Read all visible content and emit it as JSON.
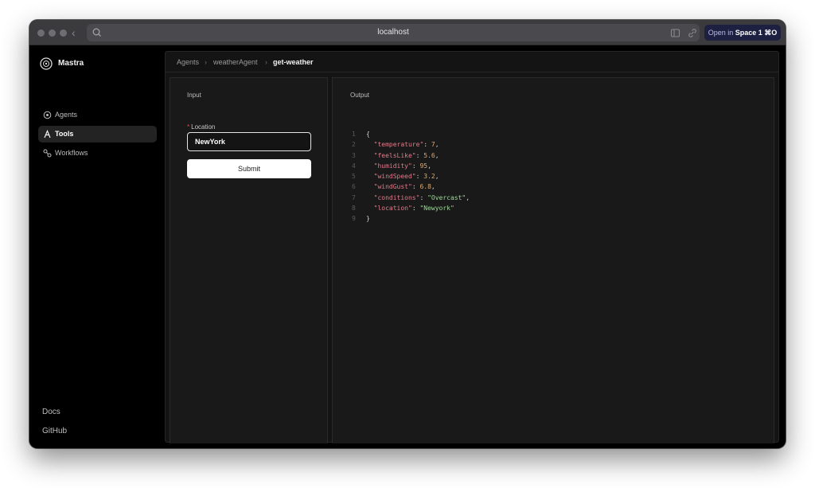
{
  "browser": {
    "url": "localhost",
    "open_in_prefix": "Open in",
    "open_in_space": "Space 1",
    "open_in_shortcut": "⌘O"
  },
  "sidebar": {
    "brand": "Mastra",
    "items": [
      {
        "label": "Agents",
        "icon": "agent-icon",
        "active": false
      },
      {
        "label": "Tools",
        "icon": "tool-icon",
        "active": true
      },
      {
        "label": "Workflows",
        "icon": "workflow-icon",
        "active": false
      }
    ],
    "footer": [
      "Docs",
      "GitHub"
    ]
  },
  "breadcrumb": [
    "Agents",
    "weatherAgent",
    "get-weather"
  ],
  "input_panel": {
    "title": "Input",
    "field_label": "Location",
    "field_required": "*",
    "field_value": "NewYork",
    "submit_label": "Submit"
  },
  "output_panel": {
    "title": "Output",
    "lines": [
      {
        "num": "1",
        "text": "{"
      },
      {
        "num": "2",
        "key": "\"temperature\"",
        "value": "7",
        "type": "number",
        "trail": ","
      },
      {
        "num": "3",
        "key": "\"feelsLike\"",
        "value": "5.6",
        "type": "number",
        "trail": ","
      },
      {
        "num": "4",
        "key": "\"humidity\"",
        "value": "95",
        "type": "number",
        "trail": ","
      },
      {
        "num": "5",
        "key": "\"windSpeed\"",
        "value": "3.2",
        "type": "number",
        "trail": ","
      },
      {
        "num": "6",
        "key": "\"windGust\"",
        "value": "6.8",
        "type": "number",
        "trail": ","
      },
      {
        "num": "7",
        "key": "\"conditions\"",
        "value": "\"Overcast\"",
        "type": "string",
        "trail": ","
      },
      {
        "num": "8",
        "key": "\"location\"",
        "value": "\"Newyork\"",
        "type": "string",
        "trail": ""
      },
      {
        "num": "9",
        "text": "}"
      }
    ]
  },
  "colors": {
    "accent_key": "#e07b8a",
    "accent_number": "#e0a96d",
    "accent_string": "#9fd89a",
    "required": "#e5484d"
  }
}
